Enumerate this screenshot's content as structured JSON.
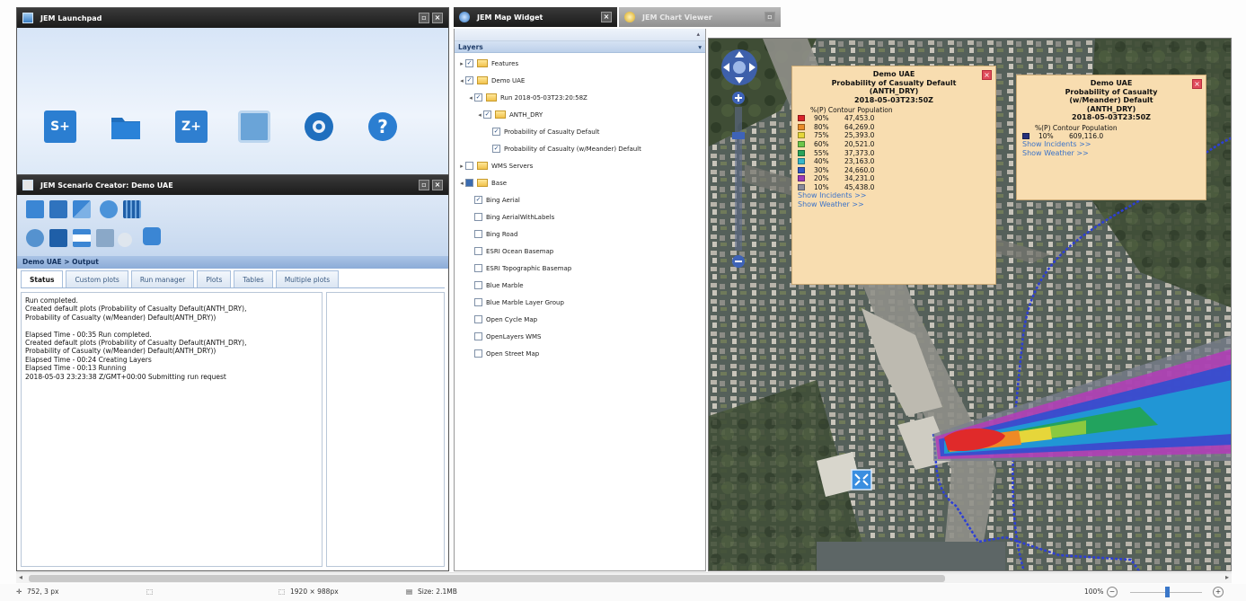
{
  "launchpad": {
    "title": "JEM Launchpad",
    "icons": [
      "new-scenario-icon",
      "open-folder-icon",
      "zip-icon",
      "image-icon",
      "settings-icon",
      "help-icon"
    ],
    "new_label": "S+",
    "zip_label": "Z+",
    "help_glyph": "?"
  },
  "scenario": {
    "title": "JEM Scenario Creator: Demo UAE",
    "breadcrumb": "Demo UAE > Output",
    "tabs": [
      "Status",
      "Custom plots",
      "Run manager",
      "Plots",
      "Tables",
      "Multiple plots"
    ],
    "active_tab": "Status",
    "log_lines": [
      "Run completed.",
      "Created default plots (Probability of Casualty Default(ANTH_DRY),",
      "Probability of Casualty  (w/Meander) Default(ANTH_DRY))",
      "",
      "Elapsed Time - 00:35 Run completed.",
      "Created default plots (Probability of Casualty Default(ANTH_DRY),",
      "Probability of Casualty  (w/Meander) Default(ANTH_DRY))",
      "Elapsed Time - 00:24 Creating Layers",
      "Elapsed Time - 00:13 Running",
      "2018-05-03 23:23:38 Z/GMT+00:00 Submitting run request"
    ]
  },
  "mapwidget": {
    "tab_active": "JEM Map Widget",
    "tab_inactive": "JEM Chart Viewer",
    "layers_header": "Layers",
    "tree": [
      {
        "label": "Features",
        "indent": 0,
        "expander": "▸",
        "check": "checked",
        "folder": true
      },
      {
        "label": "Demo UAE",
        "indent": 0,
        "expander": "◂",
        "check": "checked",
        "folder": true
      },
      {
        "label": "Run 2018-05-03T23:20:58Z",
        "indent": 1,
        "expander": "◂",
        "check": "checked",
        "folder": true
      },
      {
        "label": "ANTH_DRY",
        "indent": 2,
        "expander": "◂",
        "check": "checked",
        "folder": true
      },
      {
        "label": "Probability of Casualty Default",
        "indent": 3,
        "expander": "",
        "check": "checked",
        "folder": false
      },
      {
        "label": "Probability of Casualty (w/Meander) Default",
        "indent": 3,
        "expander": "",
        "check": "checked",
        "folder": false
      },
      {
        "label": "WMS Servers",
        "indent": 0,
        "expander": "▸",
        "check": "none",
        "folder": true
      },
      {
        "label": "Base",
        "indent": 0,
        "expander": "◂",
        "check": "partial",
        "folder": true
      },
      {
        "label": "Bing Aerial",
        "indent": 1,
        "expander": "",
        "check": "checked",
        "folder": false
      },
      {
        "label": "Bing AerialWithLabels",
        "indent": 1,
        "expander": "",
        "check": "none",
        "folder": false
      },
      {
        "label": "Bing Road",
        "indent": 1,
        "expander": "",
        "check": "none",
        "folder": false
      },
      {
        "label": "ESRI Ocean Basemap",
        "indent": 1,
        "expander": "",
        "check": "none",
        "folder": false
      },
      {
        "label": "ESRI Topographic Basemap",
        "indent": 1,
        "expander": "",
        "check": "none",
        "folder": false
      },
      {
        "label": "Blue Marble",
        "indent": 1,
        "expander": "",
        "check": "none",
        "folder": false
      },
      {
        "label": "Blue Marble Layer Group",
        "indent": 1,
        "expander": "",
        "check": "none",
        "folder": false
      },
      {
        "label": "Open Cycle Map",
        "indent": 1,
        "expander": "",
        "check": "none",
        "folder": false
      },
      {
        "label": "OpenLayers WMS",
        "indent": 1,
        "expander": "",
        "check": "none",
        "folder": false
      },
      {
        "label": "Open Street Map",
        "indent": 1,
        "expander": "",
        "check": "none",
        "folder": false
      }
    ]
  },
  "popup1": {
    "title_lines": [
      "Demo UAE",
      "Probability of Casualty Default",
      "(ANTH_DRY)",
      "2018-05-03T23:50Z"
    ],
    "columns": "%(P)   Contour Population",
    "rows": [
      {
        "pct": "90%",
        "value": "47,453.0",
        "color": "#d9252a"
      },
      {
        "pct": "80%",
        "value": "64,269.0",
        "color": "#e98c2a"
      },
      {
        "pct": "75%",
        "value": "25,393.0",
        "color": "#e6d63a"
      },
      {
        "pct": "60%",
        "value": "20,521.0",
        "color": "#6dc64a"
      },
      {
        "pct": "55%",
        "value": "37,373.0",
        "color": "#2aa35a"
      },
      {
        "pct": "40%",
        "value": "23,163.0",
        "color": "#36b6c9"
      },
      {
        "pct": "30%",
        "value": "24,660.0",
        "color": "#3257c5"
      },
      {
        "pct": "20%",
        "value": "34,231.0",
        "color": "#9c3ab8"
      },
      {
        "pct": "10%",
        "value": "45,438.0",
        "color": "#8a8a9a"
      }
    ],
    "link_incidents": "Show Incidents >>",
    "link_weather": "Show Weather >>"
  },
  "popup2": {
    "title_lines": [
      "Demo UAE",
      "Probability of Casualty",
      "(w/Meander) Default",
      "(ANTH_DRY)",
      "2018-05-03T23:50Z"
    ],
    "columns": "%(P)   Contour Population",
    "rows": [
      {
        "pct": "10%",
        "value": "609,116.0",
        "color": "#26307a"
      }
    ],
    "link_incidents": "Show Incidents >>",
    "link_weather": "Show Weather >>"
  },
  "status": {
    "coords": "752, 3 px",
    "dimensions": "1920 × 988px",
    "size": "Size: 2.1MB",
    "zoom": "100%"
  }
}
